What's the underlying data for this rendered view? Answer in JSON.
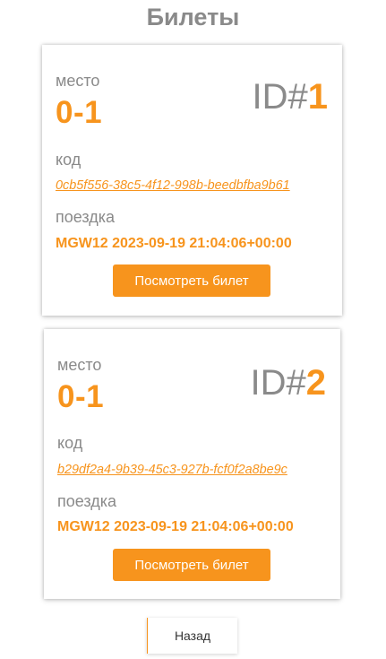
{
  "page": {
    "title": "Билеты"
  },
  "labels": {
    "seat": "место",
    "code": "код",
    "trip": "поездка"
  },
  "tickets": [
    {
      "id_prefix": "ID#",
      "id": "1",
      "seat": "0-1",
      "code": "0cb5f556-38c5-4f12-998b-beedbfba9b61",
      "trip": "MGW12 2023-09-19 21:04:06+00:00",
      "view_label": "Посмотреть билет"
    },
    {
      "id_prefix": "ID#",
      "id": "2",
      "seat": "0-1",
      "code": "b29df2a4-9b39-45c3-927b-fcf0f2a8be9c",
      "trip": "MGW12 2023-09-19 21:04:06+00:00",
      "view_label": "Посмотреть билет"
    }
  ],
  "back_label": "Назад",
  "colors": {
    "accent": "#f7941d",
    "text_muted": "#8a8a8a"
  }
}
